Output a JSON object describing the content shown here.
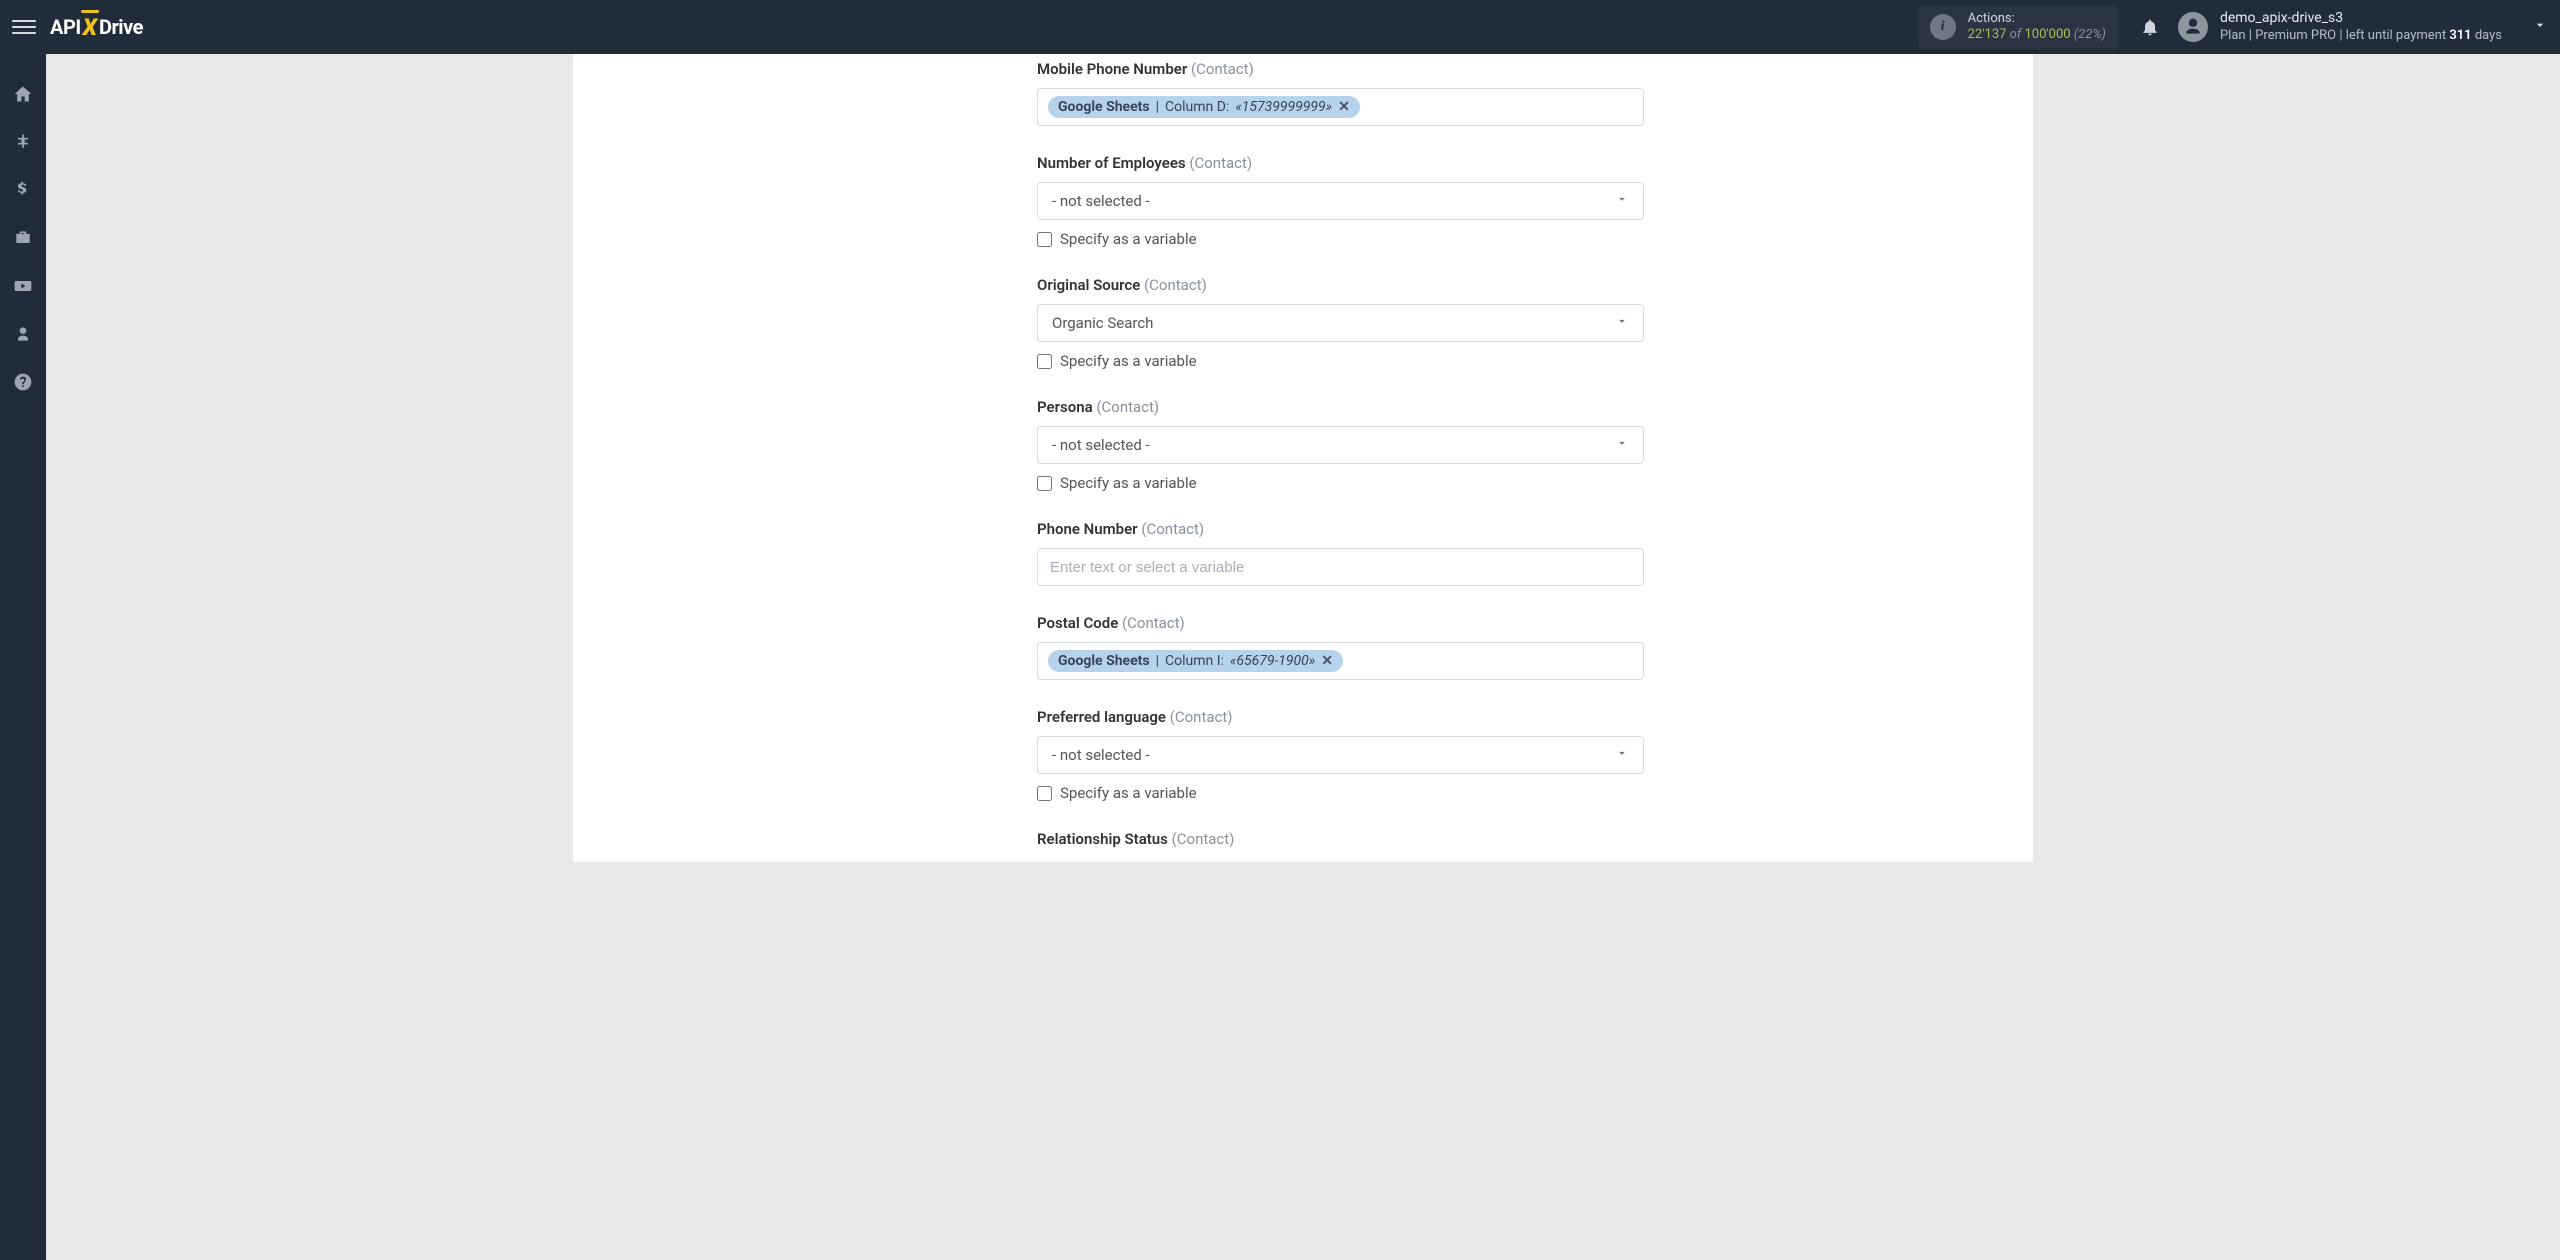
{
  "header": {
    "logo_api": "API",
    "logo_x": "X",
    "logo_drive": "Drive",
    "actions_label": "Actions:",
    "actions_used": "22'137",
    "actions_of": "of",
    "actions_total": "100'000",
    "actions_pct": "(22%)",
    "user_name": "demo_apix-drive_s3",
    "plan_prefix": "Plan |",
    "plan_name": "Premium PRO",
    "plan_mid": "| left until payment",
    "plan_days": "311",
    "plan_days_suffix": "days"
  },
  "form": {
    "specify_variable": "Specify as a variable",
    "not_selected": "- not selected -",
    "placeholder_text": "Enter text or select a variable",
    "fields": {
      "mobile": {
        "label": "Mobile Phone Number",
        "hint": "(Contact)",
        "chip_source": "Google Sheets",
        "chip_col": "Column D:",
        "chip_val": "«15739999999»"
      },
      "employees": {
        "label": "Number of Employees",
        "hint": "(Contact)"
      },
      "source": {
        "label": "Original Source",
        "hint": "(Contact)",
        "value": "Organic Search"
      },
      "persona": {
        "label": "Persona",
        "hint": "(Contact)"
      },
      "phone": {
        "label": "Phone Number",
        "hint": "(Contact)"
      },
      "postal": {
        "label": "Postal Code",
        "hint": "(Contact)",
        "chip_source": "Google Sheets",
        "chip_col": "Column I:",
        "chip_val": "«65679-1900»"
      },
      "lang": {
        "label": "Preferred language",
        "hint": "(Contact)"
      },
      "relationship": {
        "label": "Relationship Status",
        "hint": "(Contact)"
      }
    }
  }
}
